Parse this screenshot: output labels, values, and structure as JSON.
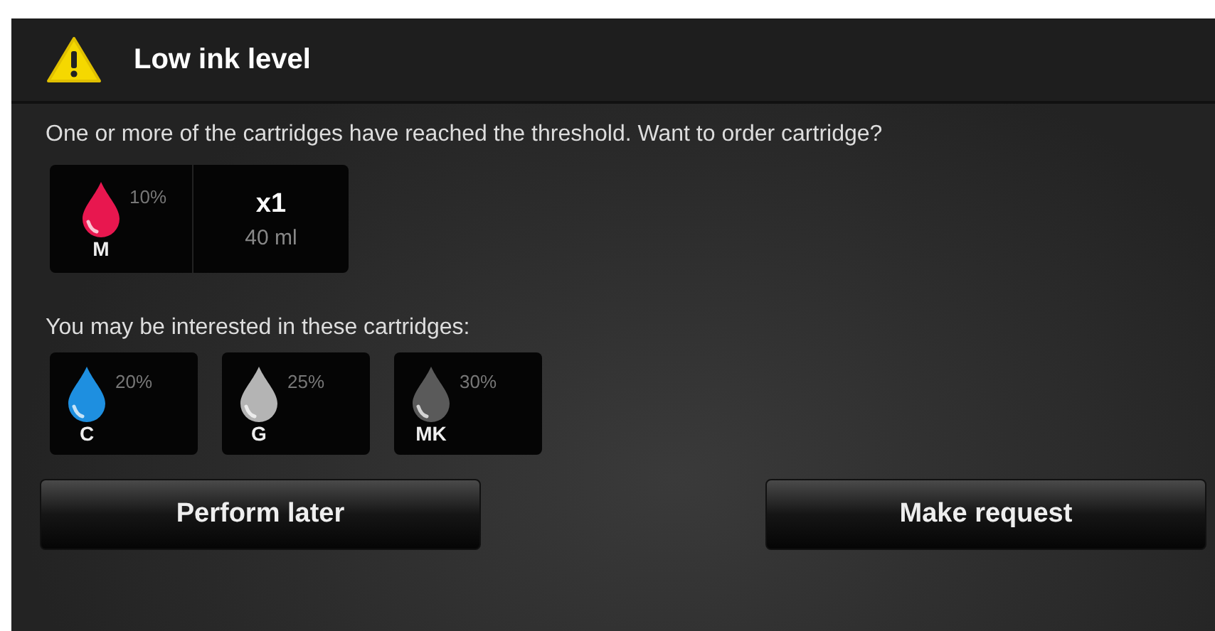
{
  "dialog": {
    "title": "Low ink level",
    "message": "One or more of the cartridges have reached the threshold. Want to order cartridge?",
    "order": {
      "cartridge": {
        "name": "M",
        "percent": "10%",
        "color": "#e8174f"
      },
      "quantity": "x1",
      "volume": "40 ml"
    },
    "suggestions_label": "You may be interested in these cartridges:",
    "suggestions": [
      {
        "name": "C",
        "percent": "20%",
        "color": "#1e8fe0"
      },
      {
        "name": "G",
        "percent": "25%",
        "color": "#b4b4b4"
      },
      {
        "name": "MK",
        "percent": "30%",
        "color": "#5a5a5a"
      }
    ],
    "buttons": [
      "Perform later",
      "Make request"
    ]
  }
}
